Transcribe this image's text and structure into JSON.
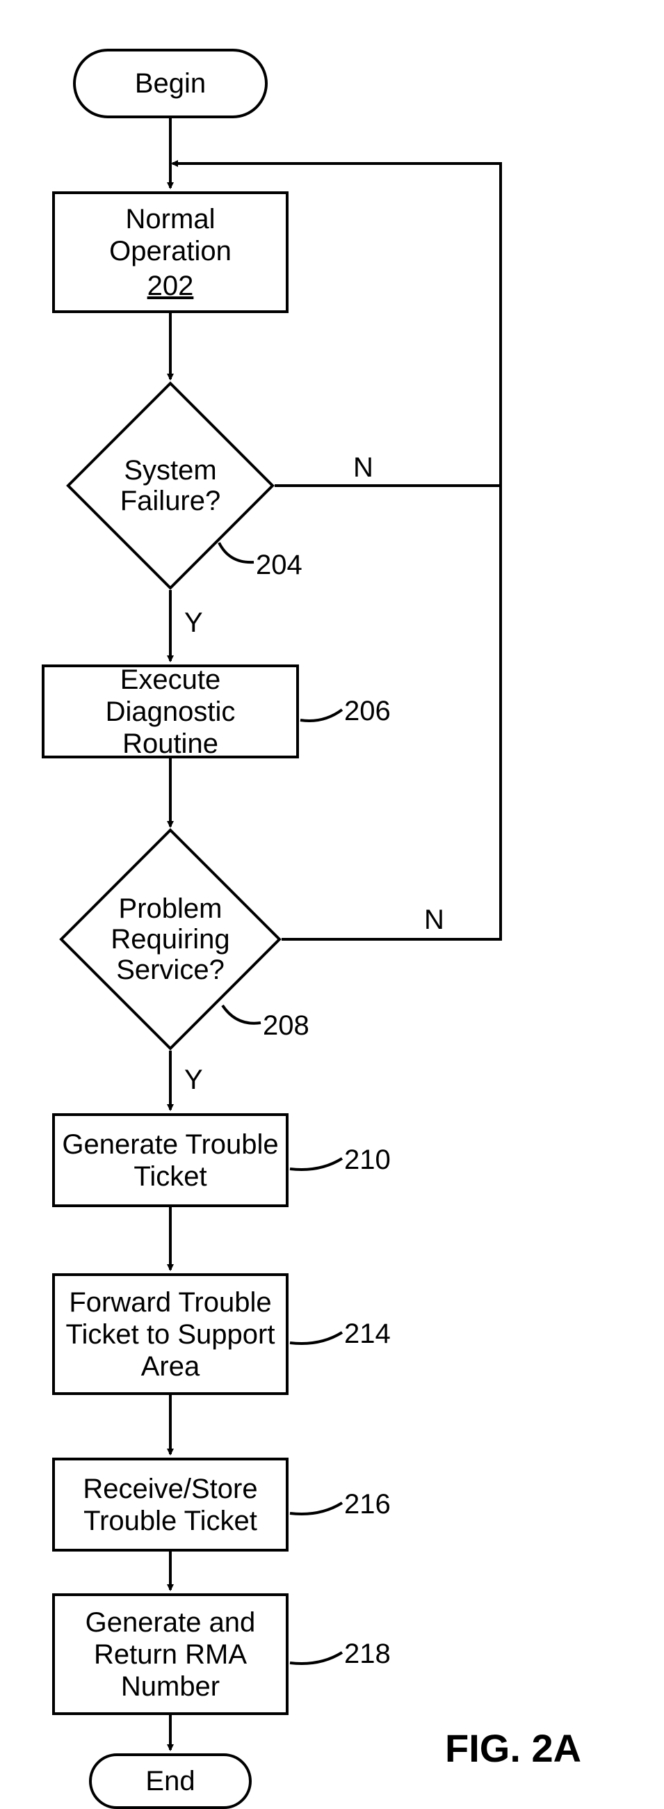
{
  "chart_data": {
    "type": "flowchart",
    "title": "FIG. 2A",
    "nodes": [
      {
        "id": "begin",
        "type": "terminator",
        "label": "Begin"
      },
      {
        "id": "normal_op",
        "type": "process",
        "label": "Normal Operation",
        "ref": "202"
      },
      {
        "id": "sys_fail",
        "type": "decision",
        "label": "System Failure?",
        "ref": "204"
      },
      {
        "id": "exec_diag",
        "type": "process",
        "label": "Execute Diagnostic Routine",
        "ref": "206"
      },
      {
        "id": "prob_req",
        "type": "decision",
        "label": "Problem Requiring Service?",
        "ref": "208"
      },
      {
        "id": "gen_ticket",
        "type": "process",
        "label": "Generate Trouble Ticket",
        "ref": "210"
      },
      {
        "id": "fwd_ticket",
        "type": "process",
        "label": "Forward Trouble Ticket to Support Area",
        "ref": "214"
      },
      {
        "id": "recv_ticket",
        "type": "process",
        "label": "Receive/Store Trouble Ticket",
        "ref": "216"
      },
      {
        "id": "gen_rma",
        "type": "process",
        "label": "Generate and Return RMA Number",
        "ref": "218"
      },
      {
        "id": "end",
        "type": "terminator",
        "label": "End"
      }
    ],
    "edges": [
      {
        "from": "begin",
        "to": "normal_op"
      },
      {
        "from": "normal_op",
        "to": "sys_fail"
      },
      {
        "from": "sys_fail",
        "to": "exec_diag",
        "label": "Y"
      },
      {
        "from": "sys_fail",
        "to": "normal_op",
        "label": "N",
        "loopback": true
      },
      {
        "from": "exec_diag",
        "to": "prob_req"
      },
      {
        "from": "prob_req",
        "to": "gen_ticket",
        "label": "Y"
      },
      {
        "from": "prob_req",
        "to": "normal_op",
        "label": "N",
        "loopback": true
      },
      {
        "from": "gen_ticket",
        "to": "fwd_ticket"
      },
      {
        "from": "fwd_ticket",
        "to": "recv_ticket"
      },
      {
        "from": "recv_ticket",
        "to": "gen_rma"
      },
      {
        "from": "gen_rma",
        "to": "end"
      }
    ]
  },
  "nodes": {
    "begin": "Begin",
    "normal_op_l1": "Normal Operation",
    "normal_op_ref": "202",
    "sys_fail_l1": "System",
    "sys_fail_l2": "Failure?",
    "sys_fail_ref": "204",
    "exec_diag_l1": "Execute Diagnostic",
    "exec_diag_l2": "Routine",
    "exec_diag_ref": "206",
    "prob_req_l1": "Problem",
    "prob_req_l2": "Requiring",
    "prob_req_l3": "Service?",
    "prob_req_ref": "208",
    "gen_ticket_l1": "Generate Trouble",
    "gen_ticket_l2": "Ticket",
    "gen_ticket_ref": "210",
    "fwd_ticket_l1": "Forward Trouble",
    "fwd_ticket_l2": "Ticket to Support",
    "fwd_ticket_l3": "Area",
    "fwd_ticket_ref": "214",
    "recv_ticket_l1": "Receive/Store",
    "recv_ticket_l2": "Trouble Ticket",
    "recv_ticket_ref": "216",
    "gen_rma_l1": "Generate and",
    "gen_rma_l2": "Return RMA",
    "gen_rma_l3": "Number",
    "gen_rma_ref": "218",
    "end": "End"
  },
  "labels": {
    "Y": "Y",
    "N": "N",
    "figure": "FIG. 2A"
  }
}
